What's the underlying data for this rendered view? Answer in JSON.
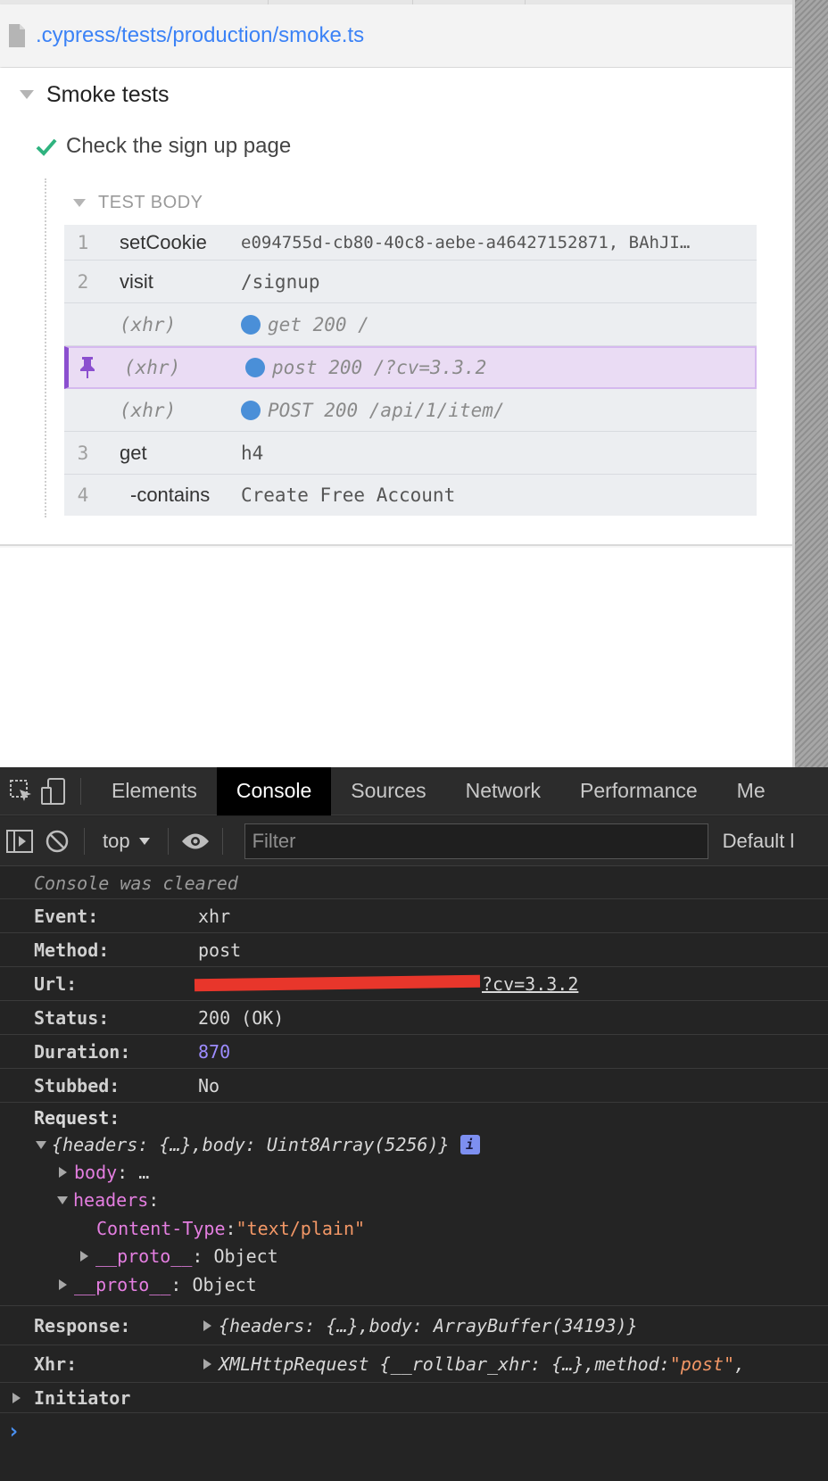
{
  "reporter": {
    "file_path": ".cypress/tests/production/smoke.ts",
    "suite_title": "Smoke tests",
    "test_title": "Check the sign up page",
    "test_body_label": "TEST BODY",
    "commands": [
      {
        "num": "1",
        "name": "setCookie",
        "message": "e094755d-cb80-40c8-aebe-a46427152871, BAhJI…"
      },
      {
        "num": "2",
        "name": "visit",
        "message": "/signup"
      },
      {
        "num": "",
        "name": "(xhr)",
        "message": "get 200 /"
      },
      {
        "num": "",
        "name": "(xhr)",
        "message": "post 200 /?cv=3.3.2"
      },
      {
        "num": "",
        "name": "(xhr)",
        "message": "POST 200 /api/1/item/"
      },
      {
        "num": "3",
        "name": "get",
        "message": "h4"
      },
      {
        "num": "4",
        "name": "-contains",
        "message": "Create Free Account"
      }
    ],
    "colors": {
      "link": "#3b82f6",
      "check": "#2fb37f",
      "pin": "#8b4fcf",
      "xhr_dot": "#4a8fd8"
    }
  },
  "devtools": {
    "tabs": [
      "Elements",
      "Console",
      "Sources",
      "Network",
      "Performance",
      "Me"
    ],
    "active_tab": "Console",
    "context": "top",
    "filter_placeholder": "Filter",
    "levels": "Default l",
    "console": {
      "cleared": "Console was cleared",
      "event_key": "Event:",
      "event_val": "xhr",
      "method_key": "Method:",
      "method_val": "post",
      "url_key": "Url:",
      "url_val": "?cv=3.3.2",
      "status_key": "Status:",
      "status_val": "200 (OK)",
      "duration_key": "Duration:",
      "duration_val": "870",
      "stubbed_key": "Stubbed:",
      "stubbed_val": "No",
      "request_key": "Request:",
      "request_summary_a": "{",
      "request_headers_key": "headers",
      "request_headers_val": ": {…}, ",
      "request_body_key": "body",
      "request_body_val": ": Uint8Array(5256)}",
      "body_key": "body",
      "body_val": ": …",
      "headers_key": "headers",
      "headers_colon": ":",
      "content_type_key": "Content-Type",
      "content_type_sep": ": ",
      "content_type_val": "\"text/plain\"",
      "proto_key": "__proto__",
      "proto_val": ": Object",
      "response_key": "Response:",
      "response_a": "{",
      "response_headers_key": "headers",
      "response_headers_val": ": {…}, ",
      "response_body_key": "body",
      "response_body_val": ": ArrayBuffer(34193)}",
      "xhr_key": "Xhr:",
      "xhr_a": "XMLHttpRequest {",
      "xhr_rollbar_key": "__rollbar_xhr",
      "xhr_rollbar_val": ": {…}, ",
      "xhr_method_key": "method",
      "xhr_method_sep": ": ",
      "xhr_method_val": "\"post\"",
      "xhr_tail": ",",
      "initiator": "Initiator",
      "prompt": "›"
    }
  }
}
